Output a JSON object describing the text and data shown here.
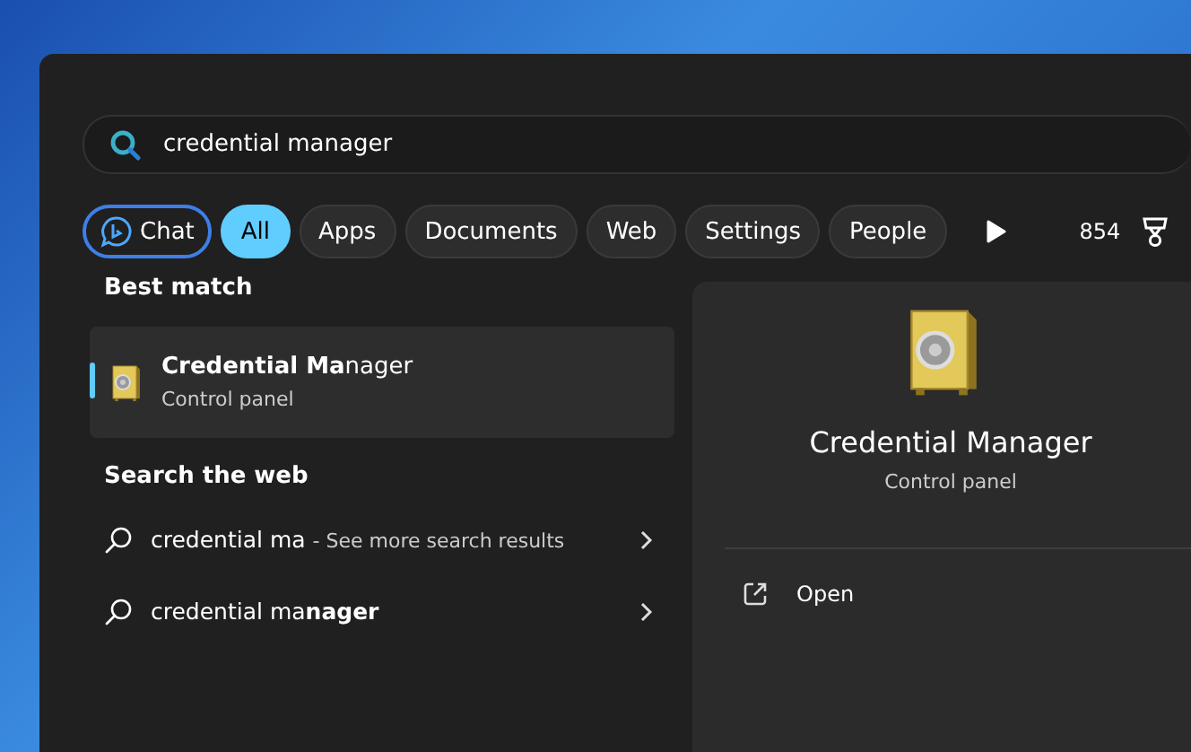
{
  "search": {
    "value": "credential manager"
  },
  "chat": {
    "label": "Chat"
  },
  "filters": [
    {
      "label": "All",
      "selected": true
    },
    {
      "label": "Apps",
      "selected": false
    },
    {
      "label": "Documents",
      "selected": false
    },
    {
      "label": "Web",
      "selected": false
    },
    {
      "label": "Settings",
      "selected": false
    },
    {
      "label": "People",
      "selected": false
    }
  ],
  "points": {
    "value": "854"
  },
  "best_match": {
    "heading": "Best match",
    "item": {
      "title": "**Credential Ma**nager",
      "subtitle": "Control panel",
      "selected": true
    }
  },
  "web": {
    "heading": "Search the web",
    "items": [
      {
        "query": "credential ma",
        "suffix": "- See more search results"
      },
      {
        "query": "credential ma**nager**"
      }
    ]
  },
  "preview": {
    "title": "Credential Manager",
    "subtitle": "Control panel",
    "actions": [
      {
        "label": "Open"
      }
    ]
  }
}
